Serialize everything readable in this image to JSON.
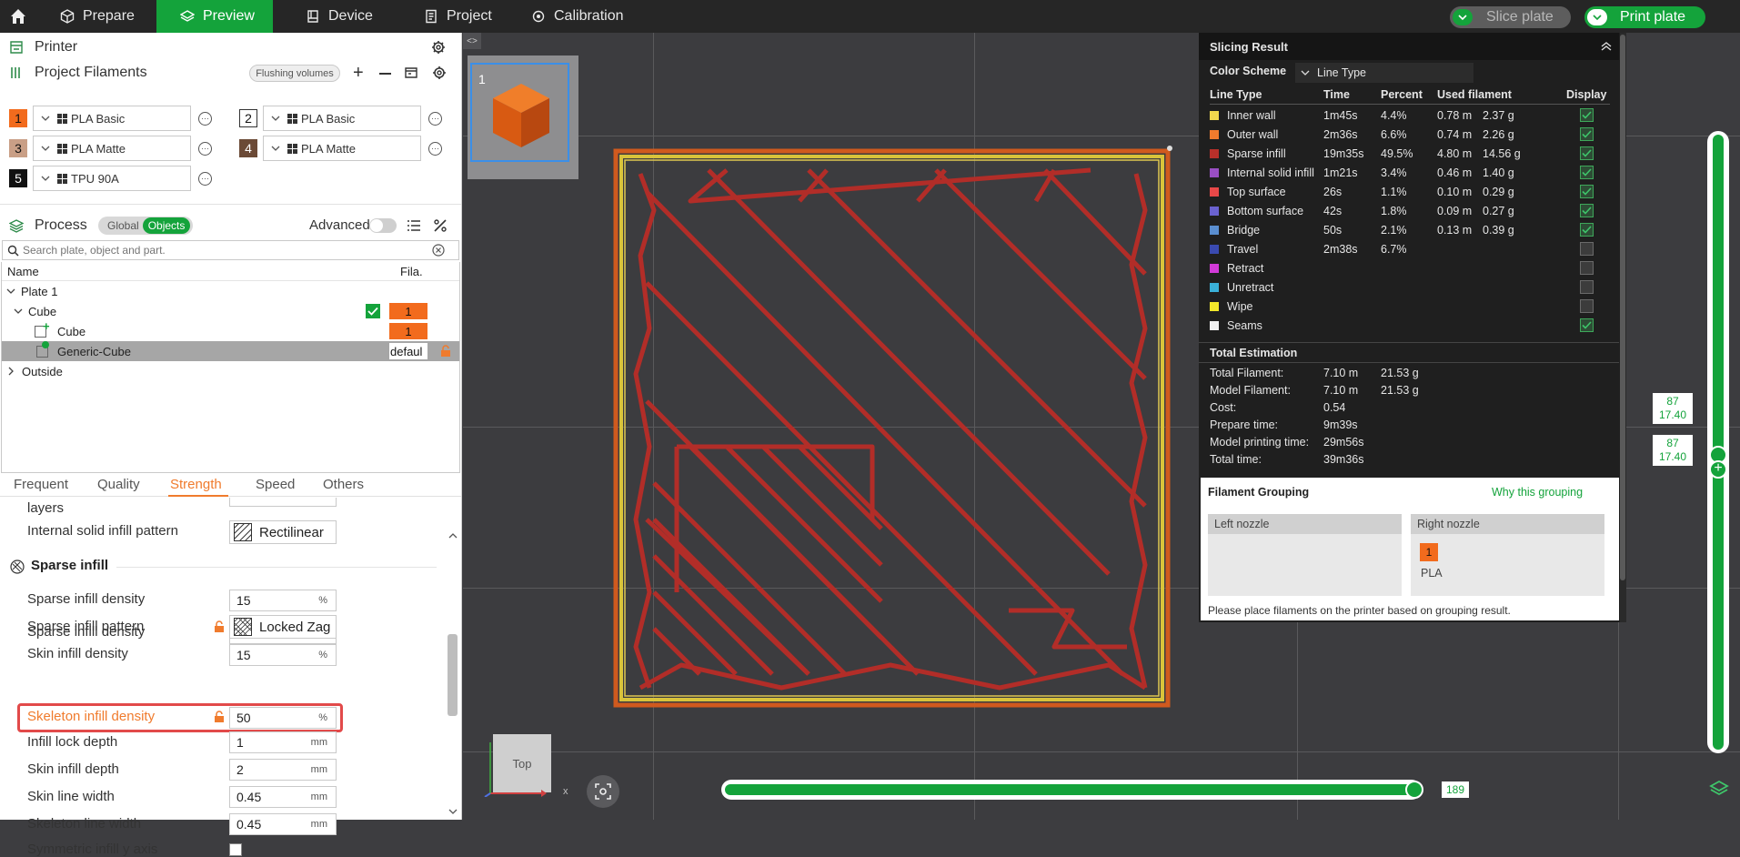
{
  "topbar": {
    "tabs": [
      "Prepare",
      "Preview",
      "Device",
      "Project",
      "Calibration"
    ],
    "active_tab": "Preview",
    "slice_plate": "Slice plate",
    "print_plate": "Print plate"
  },
  "left": {
    "printer_label": "Printer",
    "project_filaments_label": "Project Filaments",
    "flushing_volumes": "Flushing volumes",
    "filaments": [
      {
        "num": "1",
        "name": "PLA Basic",
        "color": "#f26b1d"
      },
      {
        "num": "2",
        "name": "PLA Basic",
        "color": "#ffffff"
      },
      {
        "num": "3",
        "name": "PLA Matte",
        "color": "#c99f86"
      },
      {
        "num": "4",
        "name": "PLA Matte",
        "color": "#6b4a36"
      },
      {
        "num": "5",
        "name": "TPU 90A",
        "color": "#111111"
      }
    ],
    "process_label": "Process",
    "global_label": "Global",
    "objects_label": "Objects",
    "advanced_label": "Advanced",
    "search_placeholder": "Search plate, object and part.",
    "tree_header_name": "Name",
    "tree_header_fila": "Fila.",
    "tree": {
      "plate": "Plate 1",
      "object": "Cube",
      "object_fila": "1",
      "part": "Cube",
      "part_fila": "1",
      "modifier": "Generic-Cube",
      "modifier_fila": "defaul",
      "outside": "Outside"
    },
    "param_tabs": [
      "Frequent",
      "Quality",
      "Strength",
      "Speed",
      "Others"
    ],
    "active_param_tab": "Strength",
    "params": {
      "layers_label": "layers",
      "internal_solid_pattern_label": "Internal solid infill pattern",
      "internal_solid_pattern_value": "Rectilinear",
      "sparse_section": "Sparse infill",
      "sparse_density_label": "Sparse infill density",
      "sparse_density_value": "15",
      "sparse_pattern_label": "Sparse infill pattern",
      "sparse_pattern_value": "Locked Zag",
      "skin_density_label": "Skin infill density",
      "skin_density_value": "15",
      "skeleton_density_label": "Skeleton infill density",
      "skeleton_density_value": "50",
      "lock_depth_label": "Infill lock depth",
      "lock_depth_value": "1",
      "skin_depth_label": "Skin infill depth",
      "skin_depth_value": "2",
      "skin_width_label": "Skin line width",
      "skin_width_value": "0.45",
      "skeleton_width_label": "Skeleton line width",
      "skeleton_width_value": "0.45",
      "symmetric_label": "Symmetric infill y axis",
      "unit_percent": "%",
      "unit_mm": "mm"
    }
  },
  "viewport": {
    "plate_num": "1",
    "view_label": "Top",
    "axis_x": "x",
    "horizontal_slider_value": "189",
    "layer_top_1": "87",
    "layer_top_2": "17.40",
    "layer_bottom_1": "87",
    "layer_bottom_2": "17.40"
  },
  "slicing": {
    "title": "Slicing Result",
    "color_scheme_label": "Color Scheme",
    "color_scheme_value": "Line Type",
    "headers": [
      "Line Type",
      "Time",
      "Percent",
      "Used filament",
      "Display"
    ],
    "rows": [
      {
        "name": "Inner wall",
        "time": "1m45s",
        "pct": "4.4%",
        "len": "0.78 m",
        "wt": "2.37 g",
        "color": "#f2d84d",
        "on": true
      },
      {
        "name": "Outer wall",
        "time": "2m36s",
        "pct": "6.6%",
        "len": "0.74 m",
        "wt": "2.26 g",
        "color": "#f07b2d",
        "on": true
      },
      {
        "name": "Sparse infill",
        "time": "19m35s",
        "pct": "49.5%",
        "len": "4.80 m",
        "wt": "14.56 g",
        "color": "#b8302a",
        "on": true
      },
      {
        "name": "Internal solid infill",
        "time": "1m21s",
        "pct": "3.4%",
        "len": "0.46 m",
        "wt": "1.40 g",
        "color": "#9a4fc4",
        "on": true
      },
      {
        "name": "Top surface",
        "time": "26s",
        "pct": "1.1%",
        "len": "0.10 m",
        "wt": "0.29 g",
        "color": "#e84848",
        "on": true
      },
      {
        "name": "Bottom surface",
        "time": "42s",
        "pct": "1.8%",
        "len": "0.09 m",
        "wt": "0.27 g",
        "color": "#6a62d0",
        "on": true
      },
      {
        "name": "Bridge",
        "time": "50s",
        "pct": "2.1%",
        "len": "0.13 m",
        "wt": "0.39 g",
        "color": "#5a8ed0",
        "on": true
      },
      {
        "name": "Travel",
        "time": "2m38s",
        "pct": "6.7%",
        "len": "",
        "wt": "",
        "color": "#3a4ab0",
        "on": false
      },
      {
        "name": "Retract",
        "time": "",
        "pct": "",
        "len": "",
        "wt": "",
        "color": "#d23ad8",
        "on": false
      },
      {
        "name": "Unretract",
        "time": "",
        "pct": "",
        "len": "",
        "wt": "",
        "color": "#3ab0d8",
        "on": false
      },
      {
        "name": "Wipe",
        "time": "",
        "pct": "",
        "len": "",
        "wt": "",
        "color": "#f2e82a",
        "on": false
      },
      {
        "name": "Seams",
        "time": "",
        "pct": "",
        "len": "",
        "wt": "",
        "color": "#f0f0f0",
        "on": true
      }
    ],
    "total_title": "Total Estimation",
    "totals": [
      {
        "label": "Total Filament:",
        "v1": "7.10 m",
        "v2": "21.53 g"
      },
      {
        "label": "Model Filament:",
        "v1": "7.10 m",
        "v2": "21.53 g"
      },
      {
        "label": "Cost:",
        "v1": "0.54",
        "v2": ""
      },
      {
        "label": "Prepare time:",
        "v1": "9m39s",
        "v2": ""
      },
      {
        "label": "Model printing time:",
        "v1": "29m56s",
        "v2": ""
      },
      {
        "label": "Total time:",
        "v1": "39m36s",
        "v2": ""
      }
    ],
    "grouping_title": "Filament Grouping",
    "why_grouping": "Why this grouping",
    "left_nozzle": "Left nozzle",
    "right_nozzle": "Right nozzle",
    "right_fil_num": "1",
    "right_fil_type": "PLA",
    "grouping_note": "Please place filaments on the printer based on grouping result."
  }
}
